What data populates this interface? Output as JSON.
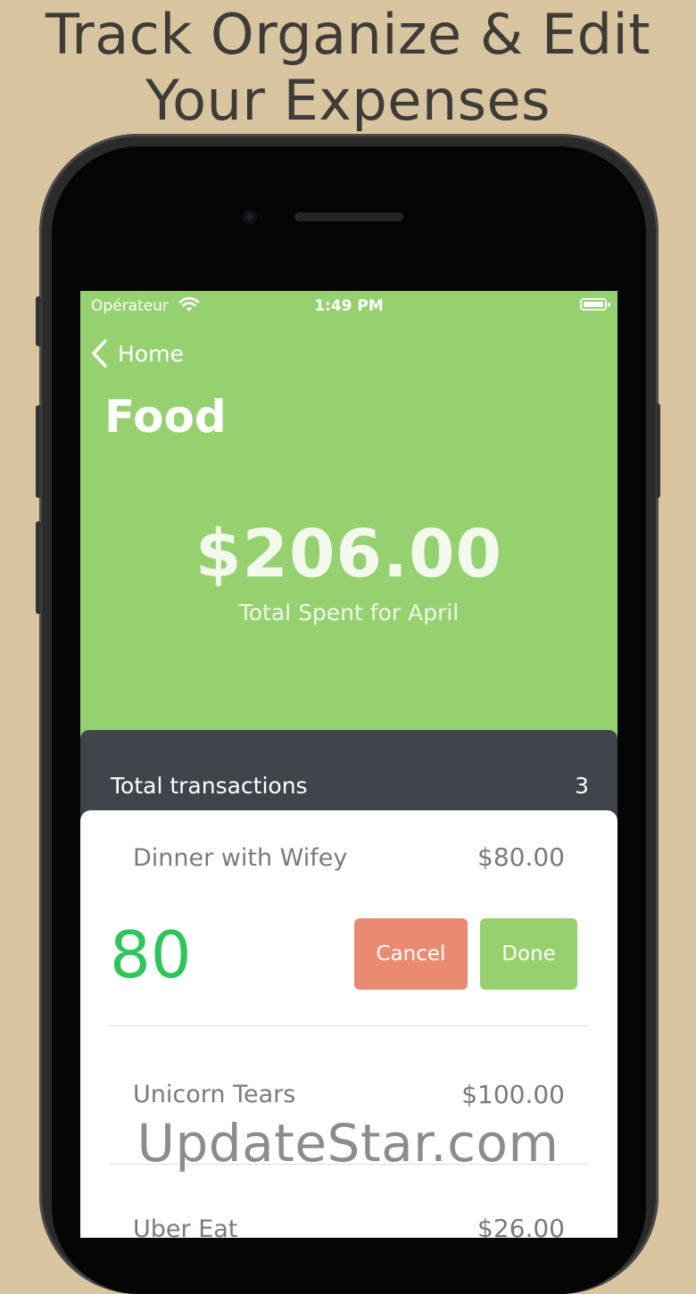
{
  "promo": {
    "line1": "Track Organize & Edit",
    "line2": "Your Expenses"
  },
  "status_bar": {
    "carrier": "Opérateur",
    "time": "1:49 PM"
  },
  "nav": {
    "back_label": "Home",
    "title": "Food"
  },
  "summary": {
    "amount": "$206.00",
    "caption": "Total Spent for April"
  },
  "transactions": {
    "label": "Total transactions",
    "count": "3",
    "items": [
      {
        "name": "Dinner with Wifey",
        "amount": "$80.00"
      },
      {
        "name": "Unicorn Tears",
        "amount": "$100.00"
      },
      {
        "name": "Uber Eat",
        "amount": "$26.00"
      }
    ]
  },
  "editor": {
    "value": "80",
    "cancel_label": "Cancel",
    "done_label": "Done"
  },
  "watermark": "UpdateStar.com",
  "colors": {
    "header_green": "#96d170",
    "value_green": "#2dc65a",
    "cancel": "#e98a71",
    "done": "#97d16d",
    "bar": "#40444b",
    "background": "#d9c4a0"
  }
}
